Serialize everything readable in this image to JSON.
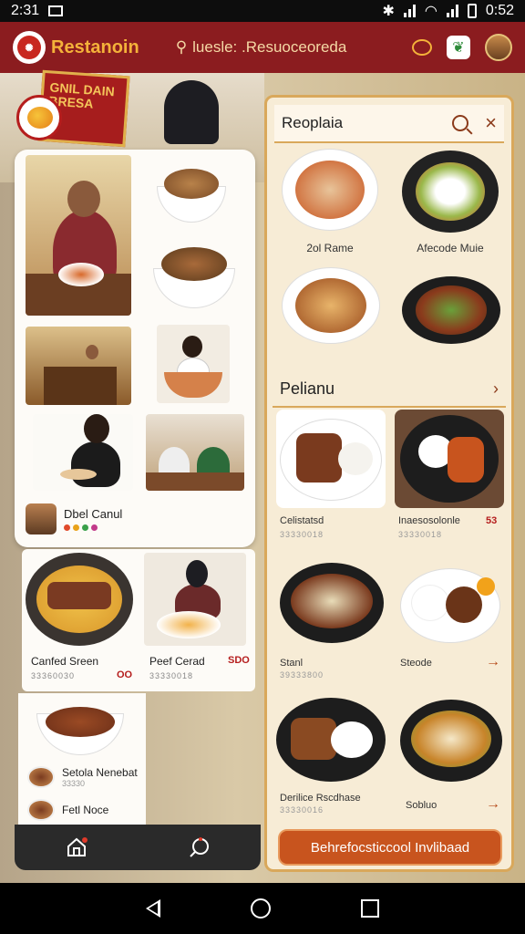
{
  "status": {
    "time": "2:31",
    "clock_right": "0:52"
  },
  "header": {
    "brand": "Restanoin",
    "search_text": "luesle: .Resuoceoreda"
  },
  "scene": {
    "sign_text": "GNIL DAIN BRESA"
  },
  "feed": {
    "user_name": "Dbel Canul",
    "dish_left_title": "Canfed Sreen",
    "dish_left_sub": "33360030",
    "dish_left_tag": "OO",
    "dish_right_title": "Peef Cerad",
    "dish_right_sub": "33330018",
    "dish_right_tag": "SDO",
    "mini_items": [
      {
        "title": "Setola Nenebat",
        "sub": "33330"
      },
      {
        "title": "Fetl Noce",
        "sub": ""
      }
    ]
  },
  "recipes": {
    "title": "Reoplaia",
    "items": [
      {
        "caption": "2ol Rame"
      },
      {
        "caption": "Afecode Muie"
      }
    ],
    "section_title": "Pelianu",
    "tiles": [
      {
        "caption": "Celistatsd",
        "sub": "33330018",
        "tag": ""
      },
      {
        "caption": "Inaesosolonle",
        "sub": "33330018",
        "tag": "53"
      },
      {
        "caption": "Stanl",
        "sub": "39333800",
        "tag": ""
      },
      {
        "caption": "Steode",
        "sub": "",
        "tag": ""
      },
      {
        "caption": "Derilice Rscdhase",
        "sub": "33330016",
        "tag": ""
      },
      {
        "caption": "Sobluo",
        "sub": "",
        "tag": ""
      }
    ],
    "cta_label": "Behrefocsticcool Invlibaad"
  },
  "colors": {
    "header_bg": "#8b1c1f",
    "brand": "#f4b23a",
    "cta": "#c8541e",
    "panel_border": "#d9a85b"
  }
}
